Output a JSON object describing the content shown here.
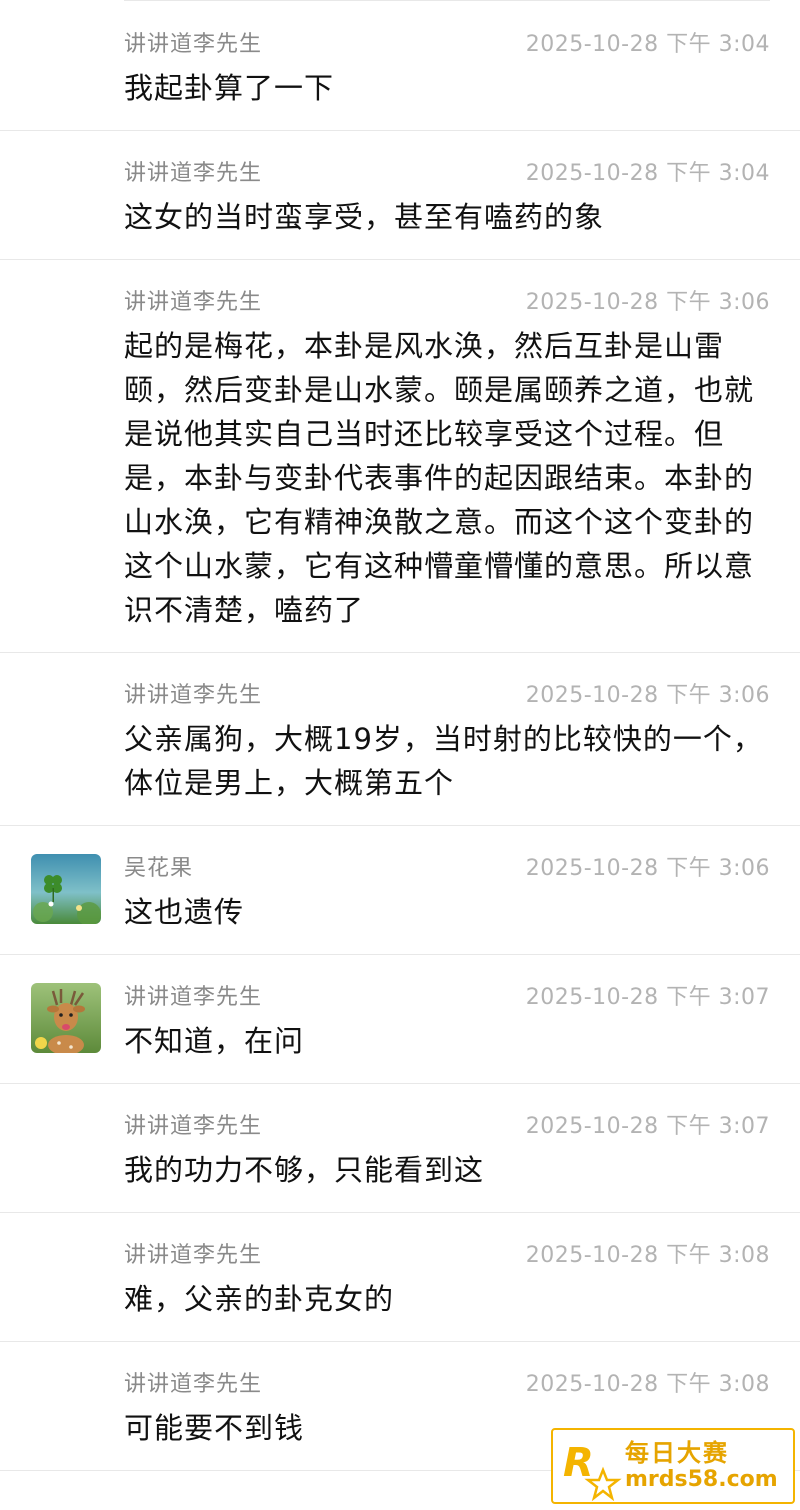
{
  "messages": [
    {
      "sender": "讲讲道李先生",
      "time": "2025-10-28 下午 3:04",
      "text": "我起卦算了一下",
      "avatar": ""
    },
    {
      "sender": "讲讲道李先生",
      "time": "2025-10-28 下午 3:04",
      "text": "这女的当时蛮享受，甚至有嗑药的象",
      "avatar": ""
    },
    {
      "sender": "讲讲道李先生",
      "time": "2025-10-28 下午 3:06",
      "text": "起的是梅花，本卦是风水涣，然后互卦是山雷颐，然后变卦是山水蒙。颐是属颐养之道，也就是说他其实自己当时还比较享受这个过程。但是，本卦与变卦代表事件的起因跟结束。本卦的山水涣，它有精神涣散之意。而这个这个变卦的这个山水蒙，它有这种懵童懵懂的意思。所以意识不清楚，嗑药了",
      "avatar": ""
    },
    {
      "sender": "讲讲道李先生",
      "time": "2025-10-28 下午 3:06",
      "text": "父亲属狗，大概19岁，当时射的比较快的一个，体位是男上，大概第五个",
      "avatar": ""
    },
    {
      "sender": "吴花果",
      "time": "2025-10-28 下午 3:06",
      "text": "这也遗传",
      "avatar": "clover-avatar"
    },
    {
      "sender": "讲讲道李先生",
      "time": "2025-10-28 下午 3:07",
      "text": "不知道，在问",
      "avatar": "deer-avatar"
    },
    {
      "sender": "讲讲道李先生",
      "time": "2025-10-28 下午 3:07",
      "text": "我的功力不够，只能看到这",
      "avatar": ""
    },
    {
      "sender": "讲讲道李先生",
      "time": "2025-10-28 下午 3:08",
      "text": "难，父亲的卦克女的",
      "avatar": ""
    },
    {
      "sender": "讲讲道李先生",
      "time": "2025-10-28 下午 3:08",
      "text": "可能要不到钱",
      "avatar": ""
    }
  ],
  "watermark": {
    "cn": "每日大赛",
    "en": "mrds58.com",
    "logo": "R"
  },
  "colors": {
    "divider": "#e8e8e8",
    "sender": "#8a8a8a",
    "time": "#b3b3b3",
    "text": "#111111",
    "watermark": "#e6a400"
  }
}
